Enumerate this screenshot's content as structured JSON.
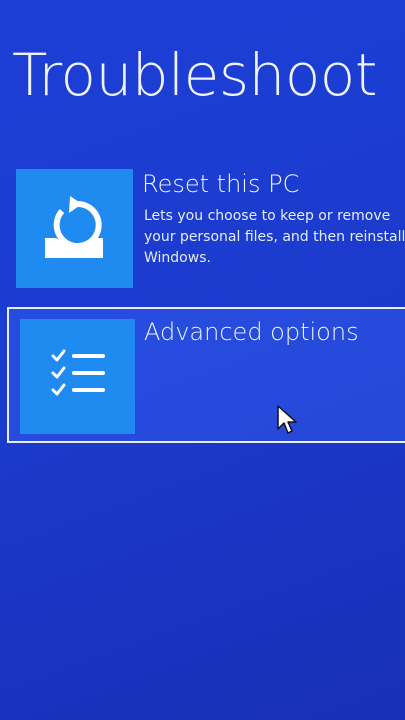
{
  "page": {
    "title": "Troubleshoot"
  },
  "options": [
    {
      "title": "Reset this PC",
      "description": "Lets you choose to keep or remove your personal files, and then reinstalls Windows.",
      "icon": "reset-pc-icon"
    },
    {
      "title": "Advanced options",
      "description": "",
      "icon": "checklist-icon"
    }
  ],
  "colors": {
    "background": "#1c3ccf",
    "tile": "#1f8af0",
    "text": "#ffffff",
    "focus_border": "#e8ecff"
  }
}
